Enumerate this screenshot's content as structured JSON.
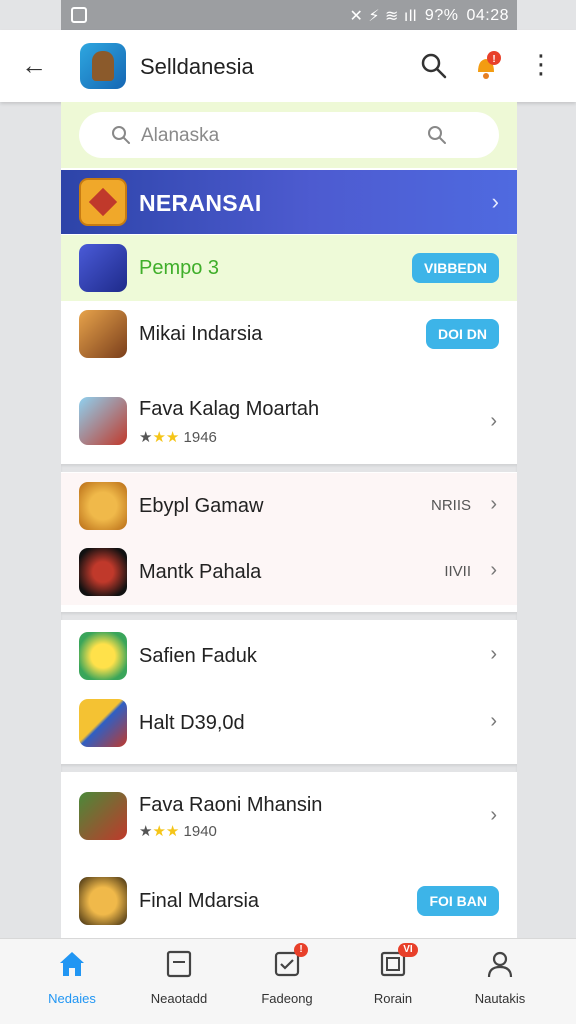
{
  "status_bar": {
    "indicators": "✕ ⚡ ≋ ıll",
    "battery": "9?%",
    "time": "04:28"
  },
  "app_bar": {
    "title": "Selldanesia",
    "notif_badge": "!"
  },
  "search": {
    "placeholder": "Alanaska"
  },
  "banner": {
    "title": "NERANSAI",
    "color_from": "#2d44a8",
    "color_to": "#4f6ae0"
  },
  "list": {
    "rows": [
      {
        "title": "Pempo 3",
        "button": "VIBBEDN",
        "title_color": "#3fae2a"
      },
      {
        "title": "Mikai Indarsia",
        "button": "DOI DN"
      },
      {
        "title": "Fava Kalag Moartah",
        "rating": "1946",
        "stars_prefix": "★",
        "stars": "★★"
      },
      {
        "title": "Ebypl Gamaw",
        "meta": "NRIIS"
      },
      {
        "title": "Mantk Pahala",
        "meta": "IIVII"
      },
      {
        "title": "Safien Faduk"
      },
      {
        "title": "Halt D39,0d"
      },
      {
        "title": "Fava Raoni Mhansin",
        "rating": "1940",
        "stars_prefix": "★",
        "stars": "★★"
      },
      {
        "title": "Final Mdarsia",
        "button": "FOI BAN"
      }
    ]
  },
  "bottom_nav": {
    "items": [
      {
        "label": "Nedaies",
        "active": true
      },
      {
        "label": "Neaotadd"
      },
      {
        "label": "Fadeong",
        "badge": "!"
      },
      {
        "label": "Rorain",
        "badge": "VI"
      },
      {
        "label": "Nautakis"
      }
    ]
  },
  "colors": {
    "accent": "#2196f3",
    "button": "#3db4e8",
    "search_bg": "#eef9d6",
    "badge": "#e8402a"
  }
}
